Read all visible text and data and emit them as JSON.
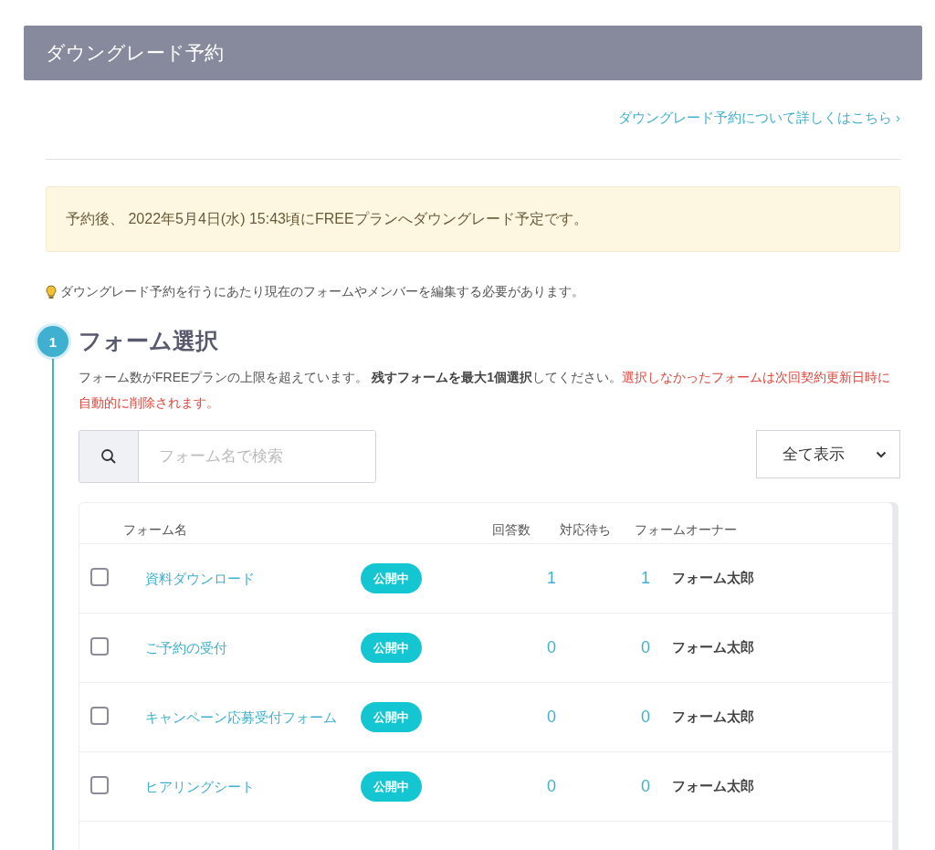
{
  "header": {
    "title": "ダウングレード予約"
  },
  "help_link": {
    "label": "ダウングレード予約について詳しくはこちら",
    "chevron": "›"
  },
  "notice": "予約後、 2022年5月4日(水) 15:43頃にFREEプランへダウングレード予定です。",
  "hint": "ダウングレード予約を行うにあたり現在のフォームやメンバーを編集する必要があります。",
  "step": {
    "number": "1",
    "title": "フォーム選択",
    "description": {
      "text": "フォーム数がFREEプランの上限を超えています。 **残すフォームを最大1個選択**してください。",
      "warning": "選択しなかったフォームは次回契約更新日時に自動的に削除されます。"
    }
  },
  "search": {
    "placeholder": "フォーム名で検索"
  },
  "filter": {
    "value": "全て表示"
  },
  "table": {
    "columns": [
      "フォーム名",
      "回答数",
      "対応待ち",
      "フォームオーナー"
    ],
    "rows": [
      {
        "checked": false,
        "name": "資料ダウンロード",
        "status": "公開中",
        "responses": "1",
        "pending": "1",
        "owner": "フォーム太郎"
      },
      {
        "checked": false,
        "name": "ご予約の受付",
        "status": "公開中",
        "responses": "0",
        "pending": "0",
        "owner": "フォーム太郎"
      },
      {
        "checked": false,
        "name": "キャンペーン応募受付フォーム",
        "status": "公開中",
        "responses": "0",
        "pending": "0",
        "owner": "フォーム太郎"
      },
      {
        "checked": false,
        "name": "ヒアリングシート",
        "status": "公開中",
        "responses": "0",
        "pending": "0",
        "owner": "フォーム太郎"
      }
    ]
  }
}
